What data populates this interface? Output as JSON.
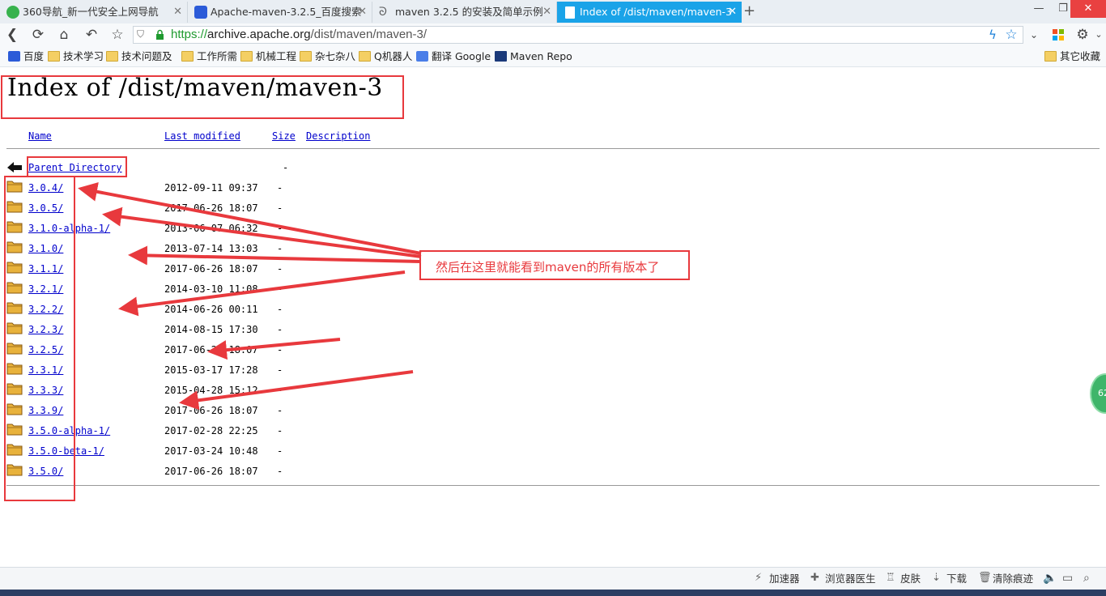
{
  "tabs": [
    {
      "title": "360导航_新一代安全上网导航",
      "active": false
    },
    {
      "title": "Apache-maven-3.2.5_百度搜索",
      "active": false
    },
    {
      "title": "maven 3.2.5 的安装及简单示例",
      "active": false
    },
    {
      "title": "Index of /dist/maven/maven-3",
      "active": true
    }
  ],
  "address": {
    "scheme": "https://",
    "host": "archive.apache.org",
    "path": "/dist/maven/maven-3/"
  },
  "bookmarks": [
    "百度",
    "技术学习",
    "技术问题及",
    "工作所需",
    "机械工程",
    "杂七杂八",
    "Q机器人",
    "翻译 Google",
    "Maven Repo"
  ],
  "bookmarks_right": "其它收藏",
  "page": {
    "title": "Index of /dist/maven/maven-3",
    "columns": {
      "name": "Name",
      "last_modified": "Last modified",
      "size": "Size",
      "description": "Description"
    },
    "parent": {
      "name": "Parent Directory",
      "size": "-"
    },
    "rows": [
      {
        "name": "3.0.4/",
        "date": "2012-09-11 09:37",
        "size": "-"
      },
      {
        "name": "3.0.5/",
        "date": "2017-06-26 18:07",
        "size": "-"
      },
      {
        "name": "3.1.0-alpha-1/",
        "date": "2013-06-07 06:32",
        "size": "-"
      },
      {
        "name": "3.1.0/",
        "date": "2013-07-14 13:03",
        "size": "-"
      },
      {
        "name": "3.1.1/",
        "date": "2017-06-26 18:07",
        "size": "-"
      },
      {
        "name": "3.2.1/",
        "date": "2014-03-10 11:08",
        "size": "-"
      },
      {
        "name": "3.2.2/",
        "date": "2014-06-26 00:11",
        "size": "-"
      },
      {
        "name": "3.2.3/",
        "date": "2014-08-15 17:30",
        "size": "-"
      },
      {
        "name": "3.2.5/",
        "date": "2017-06-26 18:07",
        "size": "-"
      },
      {
        "name": "3.3.1/",
        "date": "2015-03-17 17:28",
        "size": "-"
      },
      {
        "name": "3.3.3/",
        "date": "2015-04-28 15:12",
        "size": "-"
      },
      {
        "name": "3.3.9/",
        "date": "2017-06-26 18:07",
        "size": "-"
      },
      {
        "name": "3.5.0-alpha-1/",
        "date": "2017-02-28 22:25",
        "size": "-"
      },
      {
        "name": "3.5.0-beta-1/",
        "date": "2017-03-24 10:48",
        "size": "-"
      },
      {
        "name": "3.5.0/",
        "date": "2017-06-26 18:07",
        "size": "-"
      }
    ]
  },
  "annotation": {
    "note": "然后在这里就能看到maven的所有版本了",
    "color": "#e8393d"
  },
  "side_badge": "62",
  "statusbar": [
    "加速器",
    "浏览器医生",
    "皮肤",
    "下载",
    "清除痕迹"
  ],
  "colors": {
    "tab_active": "#1aa3e8",
    "link": "#0000cc",
    "secure": "#1f9a2f"
  }
}
